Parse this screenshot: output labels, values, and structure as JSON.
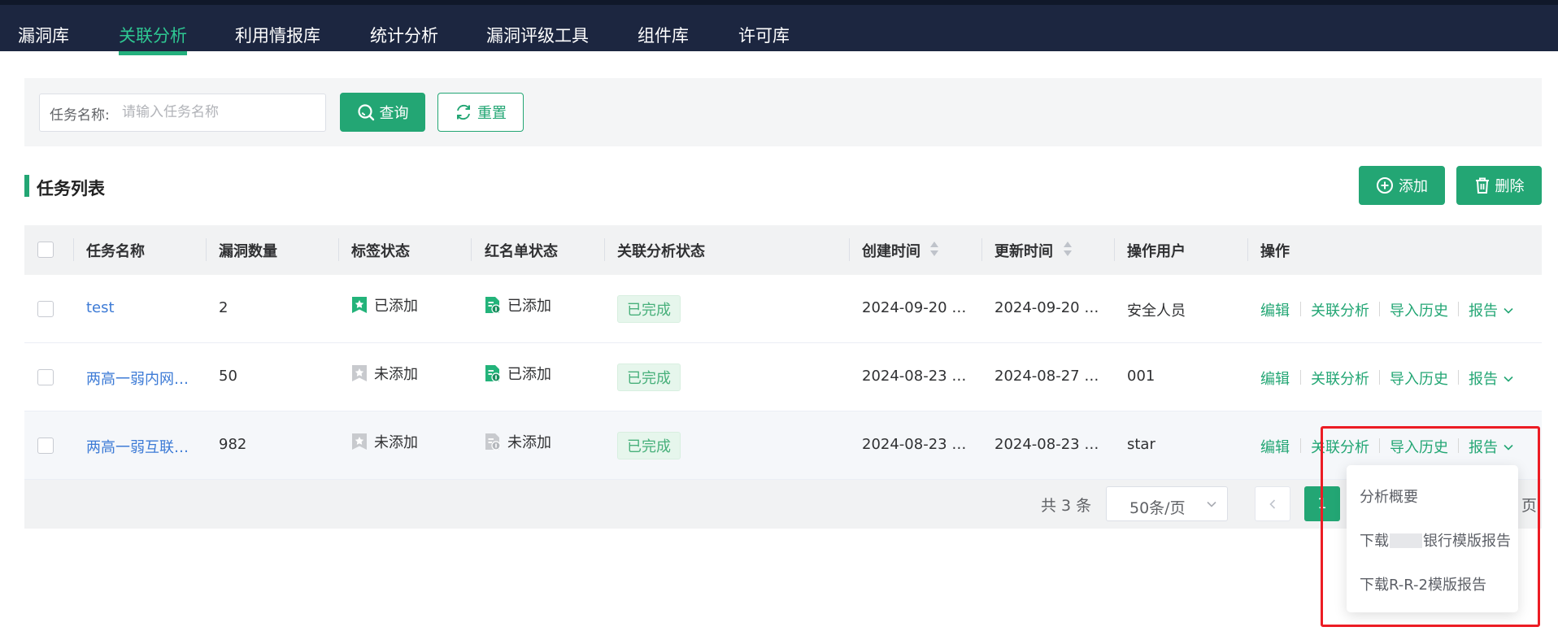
{
  "nav": {
    "items": [
      "漏洞库",
      "关联分析",
      "利用情报库",
      "统计分析",
      "漏洞评级工具",
      "组件库",
      "许可库"
    ],
    "active_index": 1
  },
  "search": {
    "label": "任务名称:",
    "placeholder": "请输入任务名称",
    "value": "",
    "query_label": "查询",
    "reset_label": "重置"
  },
  "section": {
    "title": "任务列表",
    "add_label": "添加",
    "delete_label": "删除"
  },
  "table": {
    "headers": [
      "任务名称",
      "漏洞数量",
      "标签状态",
      "红名单状态",
      "关联分析状态",
      "创建时间",
      "更新时间",
      "操作用户",
      "操作"
    ],
    "rows": [
      {
        "name": "test",
        "count": "2",
        "tag_status": "已添加",
        "tag_added": true,
        "red_status": "已添加",
        "red_added": true,
        "analysis": "已完成",
        "created": "2024-09-20 1…",
        "updated": "2024-09-20 1…",
        "user": "安全人员"
      },
      {
        "name": "两高一弱内网…",
        "count": "50",
        "tag_status": "未添加",
        "tag_added": false,
        "red_status": "已添加",
        "red_added": true,
        "analysis": "已完成",
        "created": "2024-08-23 1…",
        "updated": "2024-08-27 1…",
        "user": "001"
      },
      {
        "name": "两高一弱互联…",
        "count": "982",
        "tag_status": "未添加",
        "tag_added": false,
        "red_status": "未添加",
        "red_added": false,
        "analysis": "已完成",
        "created": "2024-08-23 1…",
        "updated": "2024-08-23 1…",
        "user": "star"
      }
    ],
    "actions": {
      "edit": "编辑",
      "analyze": "关联分析",
      "history": "导入历史",
      "report": "报告"
    }
  },
  "pagination": {
    "total": "共 3 条",
    "page_size": "50条/页",
    "current_page": "1",
    "suffix": "页"
  },
  "report_menu": {
    "items": [
      {
        "label": "分析概要"
      },
      {
        "prefix": "下载",
        "suffix": "银行模版报告"
      },
      {
        "label": "下载R-R-2模版报告"
      }
    ]
  },
  "colors": {
    "nav_bg": "#1c2640",
    "accent": "#23a674",
    "link": "#3d7bd6",
    "highlight": "#ec1c24"
  }
}
